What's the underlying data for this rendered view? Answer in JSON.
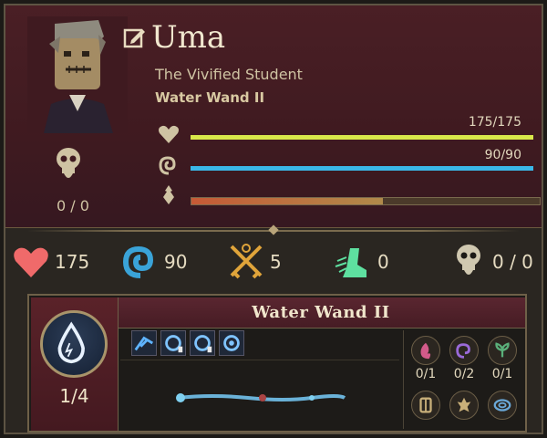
{
  "character": {
    "name": "Uma",
    "title": "The Vivified Student",
    "weapon": "Water Wand II"
  },
  "bars": {
    "health": {
      "label": "175/175",
      "current": 175,
      "max": 175,
      "color": "#d9e84a"
    },
    "mana": {
      "label": "90/90",
      "current": 90,
      "max": 90,
      "color": "#3ab8e8"
    },
    "experience": {
      "fill_fraction": 0.55,
      "color": "#c65a36"
    }
  },
  "left_stat": {
    "icon": "skull-icon",
    "value": "0 / 0"
  },
  "stats": [
    {
      "icon": "heart-icon",
      "value": "175",
      "color": "#f06a6a"
    },
    {
      "icon": "swirl-icon",
      "value": "90",
      "color": "#3aa3d8"
    },
    {
      "icon": "crossed-swords-icon",
      "value": "5",
      "color": "#e0a43a"
    },
    {
      "icon": "winged-boot-icon",
      "value": "0",
      "color": "#5ee0a0"
    },
    {
      "icon": "skull-icon",
      "value": "0 / 0",
      "color": "#d0c8b0"
    }
  ],
  "weapon_panel": {
    "title": "Water Wand II",
    "charges": "1/4",
    "spell_slots": [
      "water-spell-1",
      "water-spell-2",
      "water-spell-3",
      "water-spell-4"
    ],
    "modifiers": [
      {
        "icon": "fire-rune-icon",
        "value": "0/1",
        "color": "#d25a8a"
      },
      {
        "icon": "arcane-rune-icon",
        "value": "0/2",
        "color": "#9a6ad8"
      },
      {
        "icon": "nature-rune-icon",
        "value": "0/1",
        "color": "#5ab07a"
      },
      {
        "icon": "tome-icon",
        "value": "",
        "color": "#c9b07a"
      },
      {
        "icon": "flame-icon",
        "value": "",
        "color": "#c9b07a"
      },
      {
        "icon": "vortex-icon",
        "value": "",
        "color": "#6aa8d8"
      }
    ]
  }
}
